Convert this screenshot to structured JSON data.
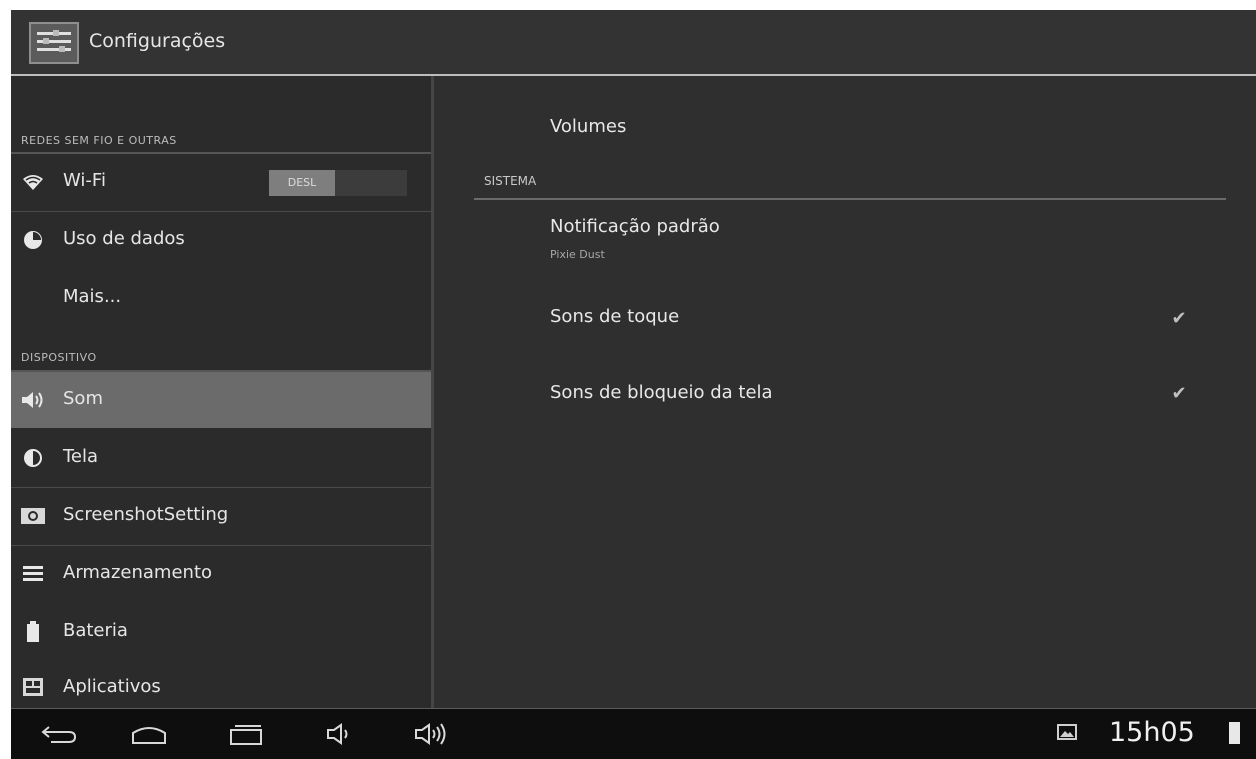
{
  "action_bar": {
    "title": "Configurações"
  },
  "left_pane": {
    "sections": [
      {
        "header": "REDES SEM FIO E OUTRAS"
      },
      {
        "header": "DISPOSITIVO"
      }
    ],
    "items": [
      {
        "label": "Wi-Fi",
        "icon": "wifi-icon",
        "toggle": "DESL"
      },
      {
        "label": "Uso de dados",
        "icon": "data-usage-icon"
      },
      {
        "label": "Mais..."
      },
      {
        "label": "Som",
        "icon": "volume-icon",
        "selected": true
      },
      {
        "label": "Tela",
        "icon": "brightness-icon"
      },
      {
        "label": "ScreenshotSetting",
        "icon": "camera-icon"
      },
      {
        "label": "Armazenamento",
        "icon": "storage-icon"
      },
      {
        "label": "Bateria",
        "icon": "battery-icon"
      },
      {
        "label": "Aplicativos",
        "icon": "apps-icon"
      }
    ]
  },
  "right_pane": {
    "volumes": "Volumes",
    "section_header": "SISTEMA",
    "default_notification": {
      "title": "Notificação padrão",
      "summary": "Pixie Dust"
    },
    "touch_sounds": {
      "title": "Sons de toque",
      "checked": true
    },
    "lock_sounds": {
      "title": "Sons de bloqueio da tela",
      "checked": true
    }
  },
  "status_bar": {
    "time": "15h05"
  }
}
